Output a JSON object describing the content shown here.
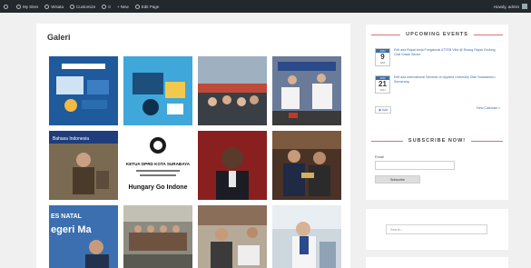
{
  "adminbar": {
    "items": [
      {
        "icon": "wordpress-icon",
        "label": ""
      },
      {
        "icon": "home-icon",
        "label": "My Sites"
      },
      {
        "icon": "site-icon",
        "label": "Wisata"
      },
      {
        "icon": "brush-icon",
        "label": "Customize"
      },
      {
        "icon": "comment-icon",
        "label": "0"
      },
      {
        "icon": "plus-icon",
        "label": "New"
      },
      {
        "icon": "pencil-icon",
        "label": "Edit Page"
      }
    ],
    "user": "Howdy, admin"
  },
  "gallery": {
    "title": "Galeri",
    "images": [
      {
        "label": "",
        "overlay": ""
      },
      {
        "label": "",
        "overlay": ""
      },
      {
        "label": "",
        "overlay": ""
      },
      {
        "label": "",
        "overlay": ""
      },
      {
        "label": "",
        "overlay": "Bahasa Indonesia"
      },
      {
        "label": "",
        "overlay": "KETUA DPRD KOTA SURABAYA"
      },
      {
        "label": "",
        "overlay": ""
      },
      {
        "label": "",
        "overlay": ""
      },
      {
        "label": "",
        "overlay": "ES NATAL"
      },
      {
        "label": "",
        "overlay": ""
      },
      {
        "label": "",
        "overlay": ""
      },
      {
        "label": "",
        "overlay": ""
      }
    ],
    "tile6_sub": "Hungary Go Indone",
    "tile9_sub": "egeri Ma"
  },
  "events": {
    "title": "UPCOMING EVENTS",
    "items": [
      {
        "month": "JUN",
        "day": "9",
        "dow": "SAT",
        "title": "Edit ada Rapat kerja Fungsional ATTEB Villa @ Ruang Rapat Gedung Graf Grade Senior"
      },
      {
        "month": "JUN",
        "day": "21",
        "dow": "THU",
        "title": "Edit ada International Seminar on Applied University Dian Nuswantoro Semarang"
      }
    ],
    "feed_label": "Add",
    "view_calendar": "View Calendar »"
  },
  "subscribe": {
    "title": "SUBSCRIBE NOW!",
    "email_label": "Email",
    "button_label": "Subscribe"
  },
  "search": {
    "placeholder": "Search..."
  },
  "colors": {
    "accent": "#e07070",
    "link": "#3a6ea5",
    "adminbar": "#23282d"
  }
}
